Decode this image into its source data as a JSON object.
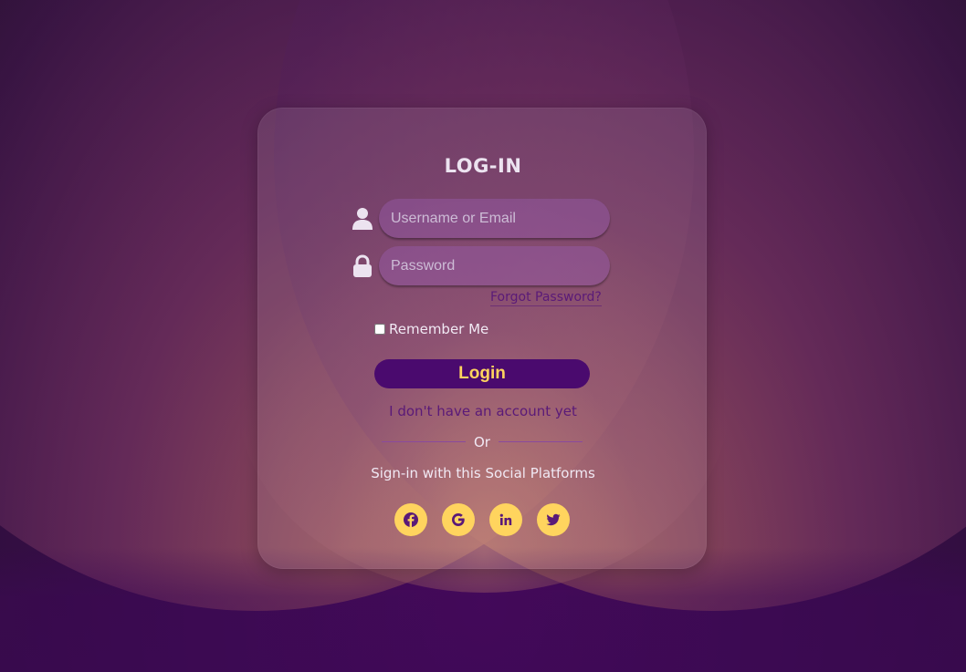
{
  "form": {
    "title": "LOG-IN",
    "username_placeholder": "Username or Email",
    "password_placeholder": "Password",
    "forgot_password": "Forgot Password?",
    "remember_me": "Remember Me",
    "login_button": "Login",
    "signup_link": "I don't have an account yet",
    "or_text": "Or",
    "social_text": "Sign-in with this Social Platforms"
  },
  "social": [
    {
      "name": "facebook-icon"
    },
    {
      "name": "google-icon"
    },
    {
      "name": "linkedin-icon"
    },
    {
      "name": "twitter-icon"
    }
  ],
  "colors": {
    "accent": "#ffd45e",
    "button_bg": "#4a0a6e",
    "link": "#5a1a78"
  }
}
